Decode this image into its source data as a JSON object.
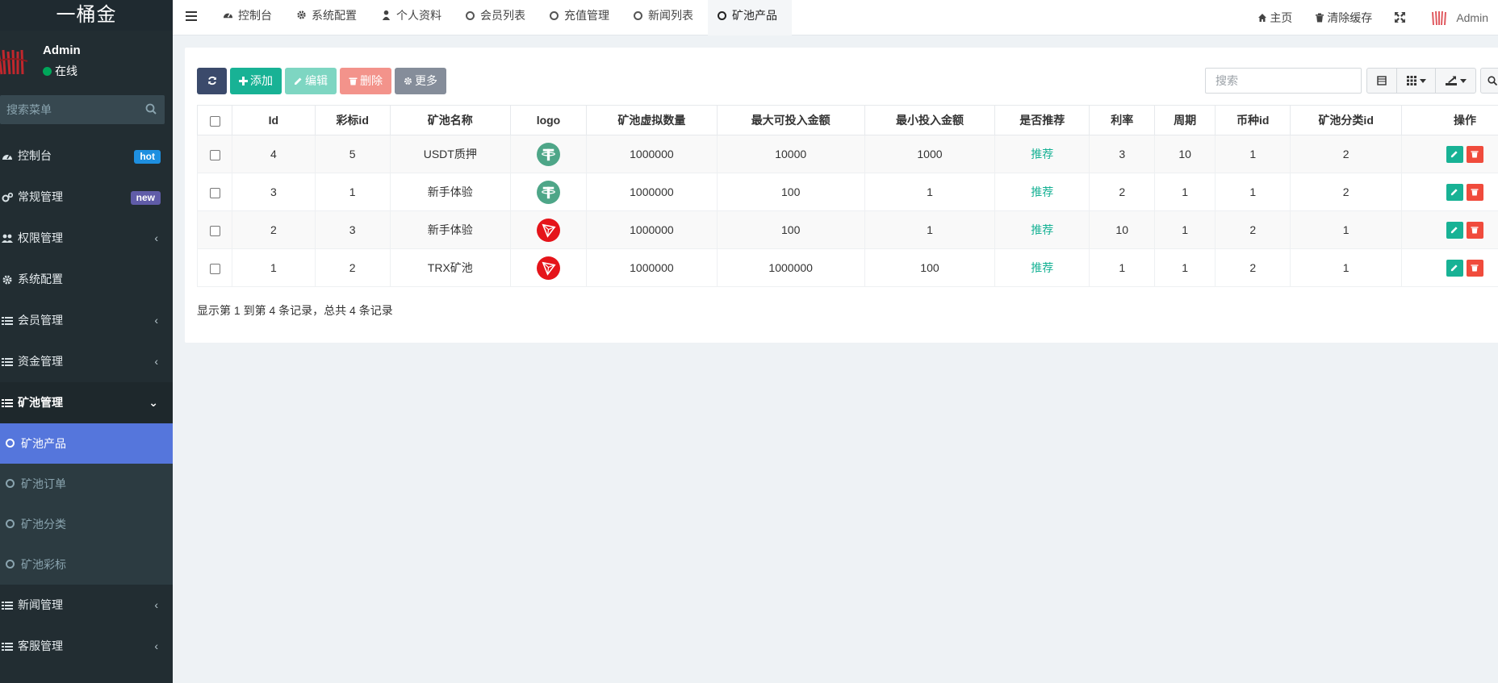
{
  "sidebar": {
    "logo": "一桶金",
    "user_name": "Admin",
    "user_status": "在线",
    "search_placeholder": "搜索菜单",
    "items": [
      {
        "label": "控制台",
        "icon": "dashboard-icon",
        "badge": "hot"
      },
      {
        "label": "常规管理",
        "icon": "cogs-icon",
        "badge": "new"
      },
      {
        "label": "权限管理",
        "icon": "users-icon",
        "arrow": "‹"
      },
      {
        "label": "系统配置",
        "icon": "gear-icon"
      },
      {
        "label": "会员管理",
        "icon": "list-icon",
        "arrow": "‹"
      },
      {
        "label": "资金管理",
        "icon": "list-icon",
        "arrow": "‹"
      },
      {
        "label": "矿池管理",
        "icon": "list-icon",
        "arrow": "⌄"
      }
    ],
    "sub_items": [
      {
        "label": "矿池产品",
        "active": true
      },
      {
        "label": "矿池订单"
      },
      {
        "label": "矿池分类"
      },
      {
        "label": "矿池彩标"
      }
    ],
    "items_after": [
      {
        "label": "新闻管理",
        "icon": "list-icon",
        "arrow": "‹"
      },
      {
        "label": "客服管理",
        "icon": "list-icon",
        "arrow": "‹"
      }
    ]
  },
  "topbar": {
    "tabs": [
      {
        "label": "控制台",
        "icon": "dashboard-icon"
      },
      {
        "label": "系统配置",
        "icon": "gear-icon"
      },
      {
        "label": "个人资料",
        "icon": "user-icon"
      },
      {
        "label": "会员列表",
        "icon": "circle-icon"
      },
      {
        "label": "充值管理",
        "icon": "circle-icon"
      },
      {
        "label": "新闻列表",
        "icon": "circle-icon"
      },
      {
        "label": "矿池产品",
        "icon": "circle-icon",
        "active": true
      }
    ],
    "home_label": "主页",
    "clear_cache_label": "清除缓存",
    "admin_label": "Admin"
  },
  "toolbar": {
    "add_label": "添加",
    "edit_label": "编辑",
    "delete_label": "删除",
    "more_label": "更多",
    "search_placeholder": "搜索"
  },
  "table": {
    "columns": [
      "Id",
      "彩标id",
      "矿池名称",
      "logo",
      "矿池虚拟数量",
      "最大可投入金额",
      "最小投入金额",
      "是否推荐",
      "利率",
      "周期",
      "币种id",
      "矿池分类id",
      "操作"
    ],
    "rows": [
      {
        "id": "4",
        "caibiao_id": "5",
        "name": "USDT质押",
        "logo": "usdt",
        "virtual_qty": "1000000",
        "max_amount": "10000",
        "min_amount": "1000",
        "recommend": "推荐",
        "rate": "3",
        "period": "10",
        "coin_id": "1",
        "category_id": "2"
      },
      {
        "id": "3",
        "caibiao_id": "1",
        "name": "新手体验",
        "logo": "usdt",
        "virtual_qty": "1000000",
        "max_amount": "100",
        "min_amount": "1",
        "recommend": "推荐",
        "rate": "2",
        "period": "1",
        "coin_id": "1",
        "category_id": "2"
      },
      {
        "id": "2",
        "caibiao_id": "3",
        "name": "新手体验",
        "logo": "trx",
        "virtual_qty": "1000000",
        "max_amount": "100",
        "min_amount": "1",
        "recommend": "推荐",
        "rate": "10",
        "period": "1",
        "coin_id": "2",
        "category_id": "1"
      },
      {
        "id": "1",
        "caibiao_id": "2",
        "name": "TRX矿池",
        "logo": "trx",
        "virtual_qty": "1000000",
        "max_amount": "1000000",
        "min_amount": "100",
        "recommend": "推荐",
        "rate": "1",
        "period": "1",
        "coin_id": "2",
        "category_id": "1"
      }
    ]
  },
  "pagination": {
    "info": "显示第 1 到第 4 条记录，总共 4 条记录"
  },
  "colors": {
    "sidebar_bg": "#222d32",
    "active_menu": "#5576dc",
    "primary_green": "#18b295",
    "danger_red": "#f04b3c",
    "usdt_green": "#4ea688",
    "trx_red": "#e5141a"
  }
}
